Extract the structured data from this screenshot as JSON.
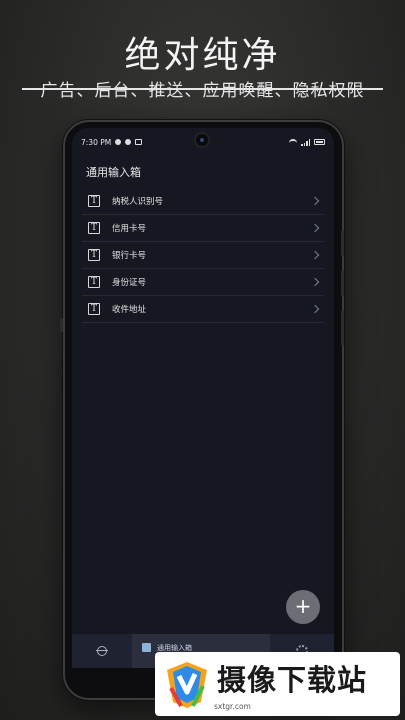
{
  "promo": {
    "title": "绝对纯净",
    "subtitle": "广告、后台、推送、应用唤醒、隐私权限"
  },
  "status_bar": {
    "time": "7:30 PM",
    "icons": [
      "person-icon",
      "chat-bubble-icon",
      "mail-icon",
      "wifi-icon",
      "signal-icon",
      "battery-icon"
    ]
  },
  "screen": {
    "page_title": "通用输入箱",
    "items": [
      {
        "label": "纳税人识别号",
        "icon": "text-box-icon"
      },
      {
        "label": "信用卡号",
        "icon": "text-box-icon"
      },
      {
        "label": "银行卡号",
        "icon": "text-box-icon"
      },
      {
        "label": "身份证号",
        "icon": "text-box-icon"
      },
      {
        "label": "收件地址",
        "icon": "text-box-icon"
      }
    ],
    "fab_label": "+",
    "item_icon_glyph": "T"
  },
  "tabbar": {
    "active_tab_label": "通用输入箱",
    "tabs": [
      "lock-icon",
      "inbox-icon",
      "gear-icon"
    ]
  },
  "watermark": {
    "text": "摄像下载站",
    "url": "sxtgr.com"
  },
  "colors": {
    "screen_bg": "#161821",
    "tabbar_bg": "#1f2230",
    "fab_bg": "#6c6e76"
  }
}
